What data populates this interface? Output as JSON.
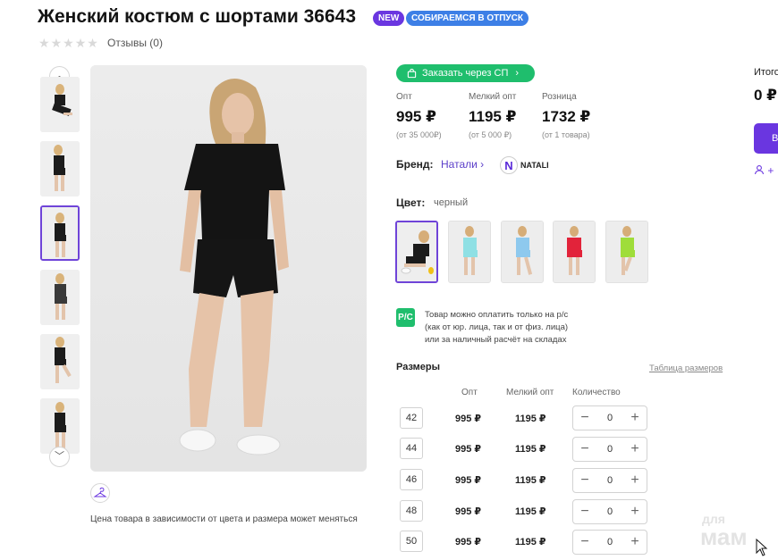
{
  "product": {
    "title": "Женский костюм с шортами 36643",
    "badges": [
      "NEW",
      "СОБИРАЕМСЯ В ОТПУСК"
    ],
    "rating_stars": 0,
    "reviews_label": "Отзывы (0)"
  },
  "gallery": {
    "thumbnails": [
      {
        "alt": "фото 1",
        "active": false
      },
      {
        "alt": "фото 2",
        "active": false
      },
      {
        "alt": "фото 3",
        "active": true
      },
      {
        "alt": "фото 4",
        "active": false
      },
      {
        "alt": "фото 5",
        "active": false
      },
      {
        "alt": "фото 6",
        "active": false
      }
    ],
    "price_note": "Цена товара в зависимости от цвета и размера может меняться"
  },
  "order_sp_label": "Заказать через СП",
  "prices": [
    {
      "label": "Опт",
      "value": "995 ₽",
      "note": "(от 35 000₽)"
    },
    {
      "label": "Мелкий опт",
      "value": "1195 ₽",
      "note": "(от 5 000 ₽)"
    },
    {
      "label": "Розница",
      "value": "1732 ₽",
      "note": "(от 1 товара)"
    }
  ],
  "brand": {
    "label": "Бренд:",
    "link": "Натали",
    "logo_text": "NATALI",
    "logo_letter": "N"
  },
  "color": {
    "label": "Цвет:",
    "value": "черный",
    "swatches": [
      {
        "name": "черный",
        "active": true,
        "hex": "#1b1b1b"
      },
      {
        "name": "голубой",
        "active": false,
        "hex": "#8fe0e4"
      },
      {
        "name": "голубой 2",
        "active": false,
        "hex": "#8ec9ee"
      },
      {
        "name": "красный",
        "active": false,
        "hex": "#e2233a"
      },
      {
        "name": "салатовый",
        "active": false,
        "hex": "#9fdd3a"
      }
    ]
  },
  "payment_note": {
    "icon_text": "Р/С",
    "lines": [
      "Товар можно оплатить только на р/с",
      "(как от юр. лица, так и от физ. лица)",
      "или за наличный расчёт на складах"
    ]
  },
  "sizes": {
    "title": "Размеры",
    "table_link": "Таблица размеров",
    "headers": [
      "Опт",
      "Мелкий опт",
      "Количество"
    ],
    "rows": [
      {
        "size": "42",
        "opt": "995 ₽",
        "small_opt": "1195 ₽",
        "qty": "0"
      },
      {
        "size": "44",
        "opt": "995 ₽",
        "small_opt": "1195 ₽",
        "qty": "0"
      },
      {
        "size": "46",
        "opt": "995 ₽",
        "small_opt": "1195 ₽",
        "qty": "0"
      },
      {
        "size": "48",
        "opt": "995 ₽",
        "small_opt": "1195 ₽",
        "qty": "0"
      },
      {
        "size": "50",
        "opt": "995 ₽",
        "small_opt": "1195 ₽",
        "qty": "0"
      }
    ]
  },
  "cart": {
    "total_label": "Итого",
    "total_value": "0 ₽",
    "button_label": "В",
    "extra_label": "+"
  },
  "watermark": {
    "line1": "для",
    "line2": "мам"
  },
  "colors": {
    "accent": "#6a36e0",
    "green": "#1fbe6d",
    "blue_badge": "#3d7fe6"
  }
}
